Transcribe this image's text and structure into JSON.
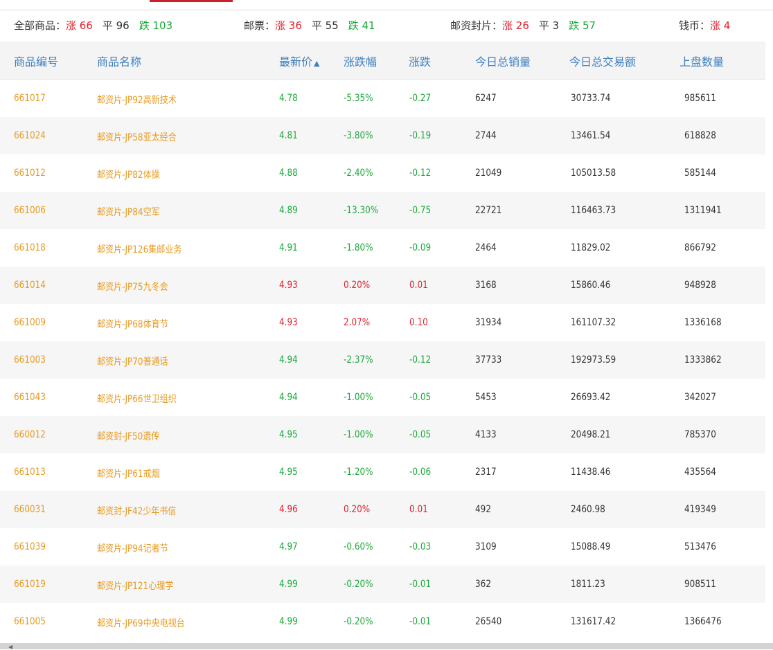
{
  "summary": [
    {
      "label": "全部商品：",
      "up": "涨 66",
      "flat": "平 96",
      "down": "跌 103"
    },
    {
      "label": "邮票：",
      "up": "涨 36",
      "flat": "平 55",
      "down": "跌 41"
    },
    {
      "label": "邮资封片：",
      "up": "涨 26",
      "flat": "平 3",
      "down": "跌 57"
    },
    {
      "label": "钱币：",
      "up": "涨 4",
      "flat": "",
      "down": ""
    }
  ],
  "table": {
    "headers": [
      "商品编号",
      "商品名称",
      "最新价",
      "涨跌幅",
      "涨跌",
      "今日总销量",
      "今日总交易额",
      "上盘数量"
    ],
    "sort_indicator": "▲",
    "rows": [
      {
        "code": "661017",
        "name": "邮资片-JP92高新技术",
        "price": "4.78",
        "pct": "-5.35%",
        "chg": "-0.27",
        "vol": "6247",
        "amount": "30733.74",
        "listed": "985611",
        "dir": "down"
      },
      {
        "code": "661024",
        "name": "邮资片-JP58亚太经合",
        "price": "4.81",
        "pct": "-3.80%",
        "chg": "-0.19",
        "vol": "2744",
        "amount": "13461.54",
        "listed": "618828",
        "dir": "down"
      },
      {
        "code": "661012",
        "name": "邮资片-JP82体操",
        "price": "4.88",
        "pct": "-2.40%",
        "chg": "-0.12",
        "vol": "21049",
        "amount": "105013.58",
        "listed": "585144",
        "dir": "down"
      },
      {
        "code": "661006",
        "name": "邮资片-JP84空军",
        "price": "4.89",
        "pct": "-13.30%",
        "chg": "-0.75",
        "vol": "22721",
        "amount": "116463.73",
        "listed": "1311941",
        "dir": "down"
      },
      {
        "code": "661018",
        "name": "邮资片-JP126集邮业务",
        "price": "4.91",
        "pct": "-1.80%",
        "chg": "-0.09",
        "vol": "2464",
        "amount": "11829.02",
        "listed": "866792",
        "dir": "down"
      },
      {
        "code": "661014",
        "name": "邮资片-JP75九冬会",
        "price": "4.93",
        "pct": "0.20%",
        "chg": "0.01",
        "vol": "3168",
        "amount": "15860.46",
        "listed": "948928",
        "dir": "up"
      },
      {
        "code": "661009",
        "name": "邮资片-JP68体育节",
        "price": "4.93",
        "pct": "2.07%",
        "chg": "0.10",
        "vol": "31934",
        "amount": "161107.32",
        "listed": "1336168",
        "dir": "up"
      },
      {
        "code": "661003",
        "name": "邮资片-JP70普通话",
        "price": "4.94",
        "pct": "-2.37%",
        "chg": "-0.12",
        "vol": "37733",
        "amount": "192973.59",
        "listed": "1333862",
        "dir": "down"
      },
      {
        "code": "661043",
        "name": "邮资片-JP66世卫组织",
        "price": "4.94",
        "pct": "-1.00%",
        "chg": "-0.05",
        "vol": "5453",
        "amount": "26693.42",
        "listed": "342027",
        "dir": "down"
      },
      {
        "code": "660012",
        "name": "邮资封-JF50遗传",
        "price": "4.95",
        "pct": "-1.00%",
        "chg": "-0.05",
        "vol": "4133",
        "amount": "20498.21",
        "listed": "785370",
        "dir": "down"
      },
      {
        "code": "661013",
        "name": "邮资片-JP61戒烟",
        "price": "4.95",
        "pct": "-1.20%",
        "chg": "-0.06",
        "vol": "2317",
        "amount": "11438.46",
        "listed": "435564",
        "dir": "down"
      },
      {
        "code": "660031",
        "name": "邮资封-JF42少年书信",
        "price": "4.96",
        "pct": "0.20%",
        "chg": "0.01",
        "vol": "492",
        "amount": "2460.98",
        "listed": "419349",
        "dir": "up"
      },
      {
        "code": "661039",
        "name": "邮资片-JP94记者节",
        "price": "4.97",
        "pct": "-0.60%",
        "chg": "-0.03",
        "vol": "3109",
        "amount": "15088.49",
        "listed": "513476",
        "dir": "down"
      },
      {
        "code": "661019",
        "name": "邮资片-JP121心理学",
        "price": "4.99",
        "pct": "-0.20%",
        "chg": "-0.01",
        "vol": "362",
        "amount": "1811.23",
        "listed": "908511",
        "dir": "down"
      },
      {
        "code": "661005",
        "name": "邮资片-JP69中央电视台",
        "price": "4.99",
        "pct": "-0.20%",
        "chg": "-0.01",
        "vol": "26540",
        "amount": "131617.42",
        "listed": "1366476",
        "dir": "down"
      }
    ]
  },
  "colors": {
    "up": "#e1232e",
    "down": "#1aaa3c",
    "link": "#e89a20",
    "header": "#3d7fc1"
  },
  "icons": {
    "scroll_left": "chevron-left-icon"
  }
}
